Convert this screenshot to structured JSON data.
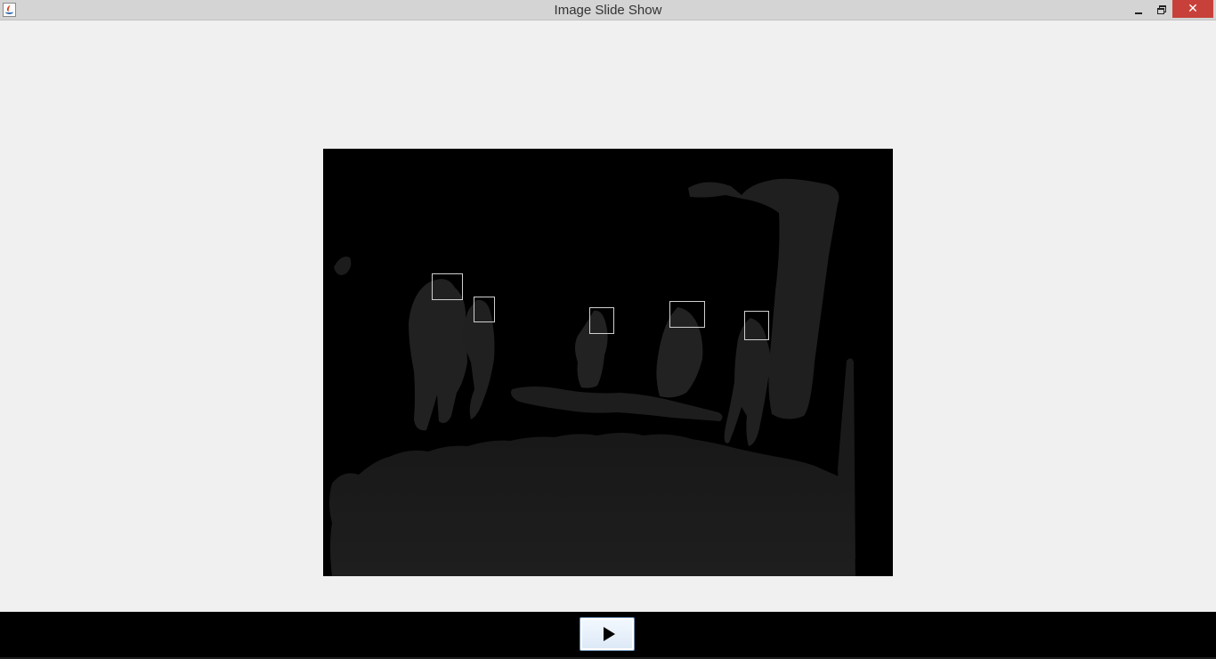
{
  "window": {
    "title": "Image Slide Show",
    "close_glyph": "✕"
  },
  "controls": {
    "play_icon": "play-icon"
  }
}
